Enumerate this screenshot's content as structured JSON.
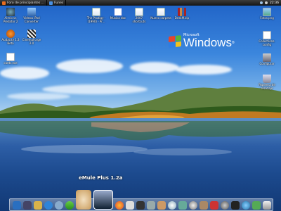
{
  "top_panel": {
    "tasks": [
      {
        "label": "Foro de principiantes ..."
      },
      {
        "label": "Funes"
      }
    ],
    "clock": "22:36"
  },
  "desktop_icons": [
    {
      "label": "Aimio vs\nPredator 2",
      "icon": "game-icon"
    },
    {
      "label": "Videoa iPod\nConverter",
      "icon": "converter-icon"
    },
    {
      "label": "Audacity 1.3\nBeta",
      "icon": "audacity-icon"
    },
    {
      "label": "CinemaForge\n2.0",
      "icon": "clapperboard-icon"
    },
    {
      "label": "cards.exe",
      "icon": "exe-file-icon"
    },
    {
      "label": "The Prodigy -\n(1990) - Pr...",
      "icon": "document-icon"
    },
    {
      "label": "Musica doc",
      "icon": "word-doc-icon"
    },
    {
      "label": "2007\nshortcuts",
      "icon": "document-icon"
    },
    {
      "label": "Nuevo carpeta",
      "icon": "document-icon"
    },
    {
      "label": "DeskM.zip",
      "icon": "zip-archive-icon"
    },
    {
      "label": "Fotos.png",
      "icon": "image-file-icon"
    },
    {
      "label": "Collections.\nconfig",
      "icon": "settings-file-icon"
    },
    {
      "label": "Configurar",
      "icon": "computer-icon"
    },
    {
      "label": "Papelera de\nreciclaje",
      "icon": "recycle-bin-icon"
    }
  ],
  "wallpaper_logo": {
    "microsoft": "Microsoft",
    "windows": "Windows",
    "reg": "®"
  },
  "dock": {
    "active_label": "eMule Plus 1.2a",
    "items": [
      "windows-icon",
      "monitor-icon",
      "folder-icon",
      "ie-icon",
      "chat-icon",
      "messenger-icon",
      "emule-rabbit-icon",
      "emule-plus-icon",
      "firefox-icon",
      "mail-icon",
      "media-icon",
      "wrench-icon",
      "tools-icon",
      "disc-icon",
      "photo-icon",
      "cd-icon",
      "box-icon",
      "film-icon",
      "gear-icon",
      "terminal-icon",
      "globe-icon",
      "settings-icon",
      "recycle-icon"
    ]
  },
  "colors": {
    "sky": "#2f76d6",
    "lake": "#1c4a8e",
    "panel": "#1e1e1e"
  }
}
